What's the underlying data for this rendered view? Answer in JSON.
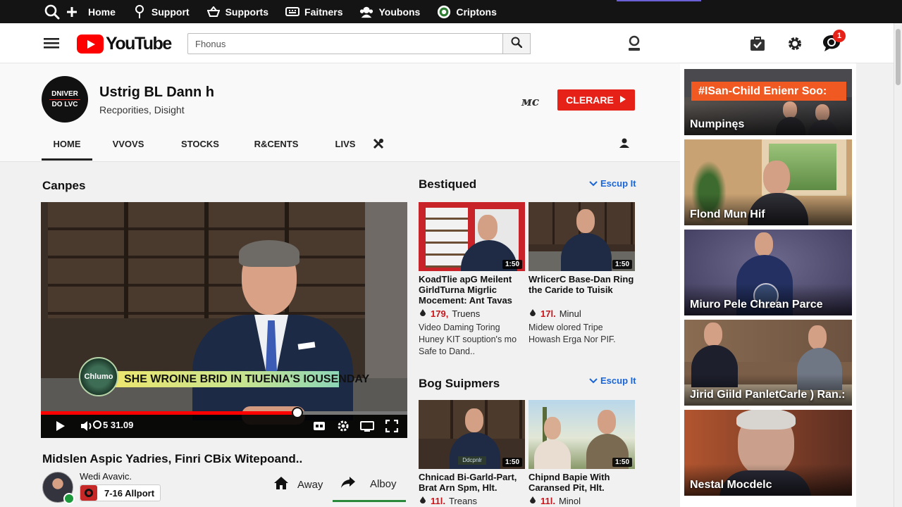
{
  "topbar": {
    "items": [
      {
        "label": "Home",
        "icon": "plus-icon"
      },
      {
        "label": "Support",
        "icon": "location-pin-icon"
      },
      {
        "label": "Supports",
        "icon": "basket-icon"
      },
      {
        "label": "Faitners",
        "icon": "keyboard-icon"
      },
      {
        "label": "Youbons",
        "icon": "people-icon"
      },
      {
        "label": "Criptons",
        "icon": "chrome-icon"
      }
    ]
  },
  "header": {
    "logo_text": "YouTube",
    "search_value": "Fhonus",
    "notification_count": "1"
  },
  "channel": {
    "avatar_line1": "DNIVER",
    "avatar_line2": "DO LVC",
    "name": "Ustrig BL Dann h",
    "subtitle": "Recporities, Disight",
    "signature": "ᴍc",
    "subscribe_label": "CLERARE",
    "tabs": [
      "HOME",
      "VVOVS",
      "STOCKS",
      "R&CENTS",
      "LIVS"
    ]
  },
  "main": {
    "section_title": "Canpes",
    "player": {
      "lower_third": "SHE WROINE BRID IN TIUENIA'S IOUSENDAY",
      "badge_text": "Chlumo",
      "time": "5 31.09",
      "progress": 0.7
    },
    "video_title": "Midslen Aspic Yadries, Finri CBix Witepoand..",
    "owner_name": "Wedi Avavic.",
    "owner_badge": "7-16 Allport",
    "actions": [
      {
        "label": "Away",
        "icon": "home-icon"
      },
      {
        "label": "Alboy",
        "icon": "share-arrow-icon"
      }
    ]
  },
  "recommended": {
    "section1_title": "Bestiqued",
    "section1_link": "Escup It",
    "section2_title": "Bog Suipmers",
    "section2_link": "Escup It",
    "cards": [
      {
        "title": "KoadTlie apG Meilent GirldTurna Migrlic Mocement: Ant Tavas",
        "meta_num": "179,",
        "meta_text": "Truens",
        "desc": "Video Daming Toring Huney KIT souption's mo Safe to Dand..",
        "duration": "1:50"
      },
      {
        "title": "WrlicerC Base-Dan Ring the Caride to Tuisik",
        "meta_num": "17l.",
        "meta_text": "Minul",
        "desc": "Midew olored Tripe Howash Erga Nor PIF.",
        "duration": "1:50"
      },
      {
        "title": "Chnicad Bi-Garld-Part, Brat Arn Spm, Hlt.",
        "meta_num": "11l.",
        "meta_text": "Treans",
        "desc": "",
        "duration": "1:50",
        "thumb_label": "Ddcpnlr"
      },
      {
        "title": "Chipnd Bapie With Caransed Pit, Hlt.",
        "meta_num": "11l.",
        "meta_text": "Minol",
        "desc": "",
        "duration": "1:50"
      }
    ]
  },
  "sidebar": {
    "cards": [
      {
        "label": "Numpinęs",
        "banner": "#ISan-Child Enienr Soo:"
      },
      {
        "label": "Flond Mun Hif"
      },
      {
        "label": "Miuro Pele Chrean Parce"
      },
      {
        "label": "Jirid Giild PanletCarle ) Ran.:"
      },
      {
        "label": "Nestal Mocdelc"
      }
    ]
  },
  "colors": {
    "accent_red": "#e62117",
    "link_blue": "#1a65d8",
    "topbar_bg": "#141414",
    "banner_orange": "#f05a22"
  }
}
